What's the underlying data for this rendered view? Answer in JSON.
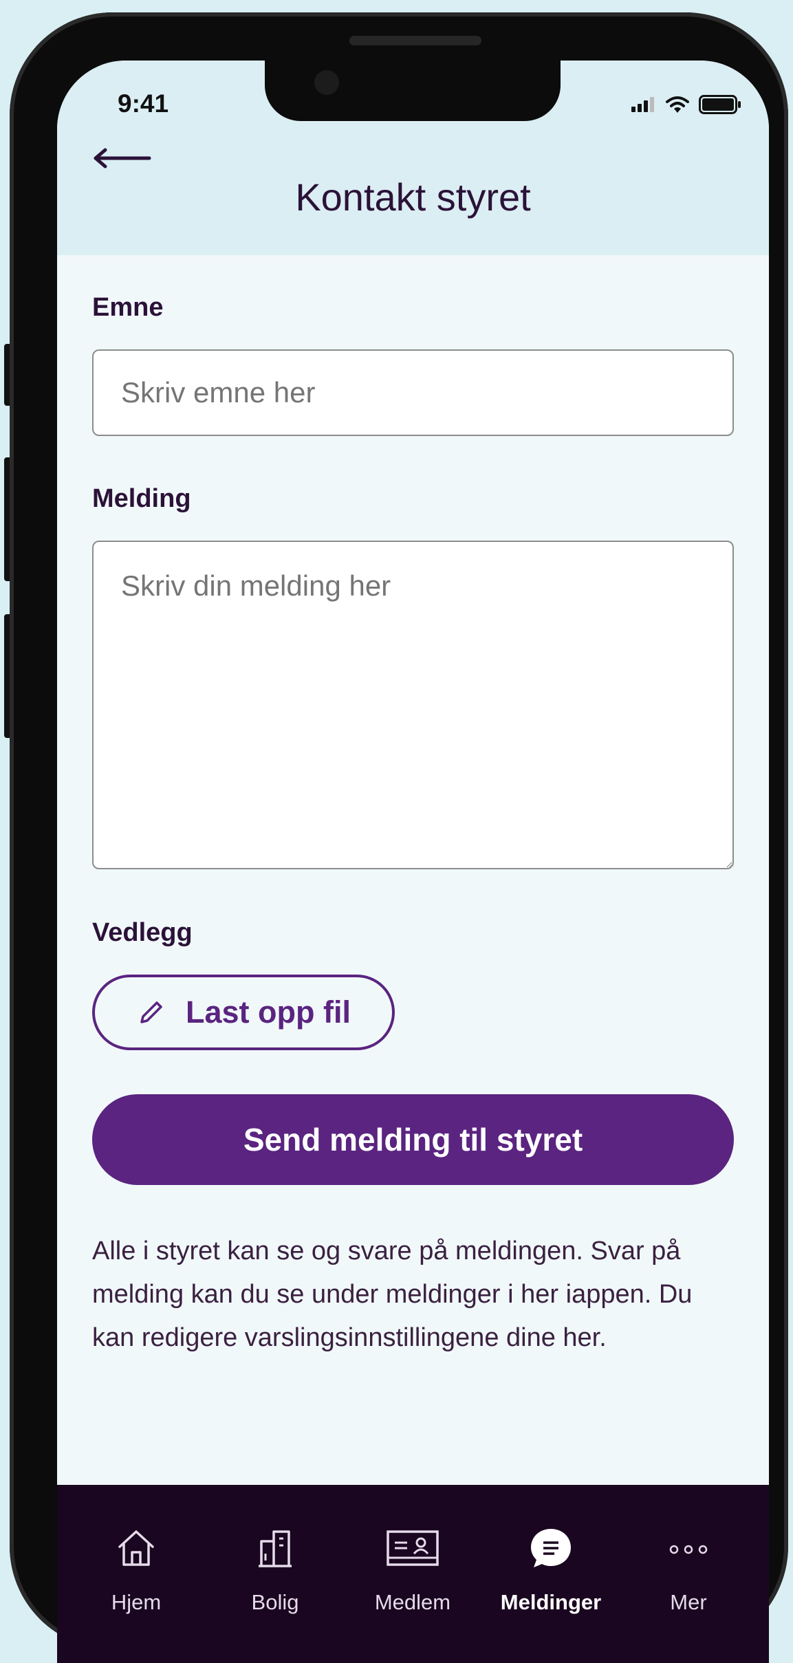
{
  "status_bar": {
    "time": "9:41"
  },
  "header": {
    "title": "Kontakt styret"
  },
  "form": {
    "subject_label": "Emne",
    "subject_placeholder": "Skriv emne her",
    "message_label": "Melding",
    "message_placeholder": "Skriv din melding her",
    "attachment_label": "Vedlegg",
    "upload_button": "Last opp fil",
    "send_button": "Send melding til styret",
    "info_text": "Alle i styret kan se og svare på meldingen. Svar på melding kan du se under meldinger i her iappen. Du kan redigere varslingsinnstillingene dine her."
  },
  "tabbar": {
    "items": [
      {
        "label": "Hjem",
        "icon": "home-icon",
        "active": false
      },
      {
        "label": "Bolig",
        "icon": "building-icon",
        "active": false
      },
      {
        "label": "Medlem",
        "icon": "member-card-icon",
        "active": false
      },
      {
        "label": "Meldinger",
        "icon": "chat-bubble-icon",
        "active": true
      },
      {
        "label": "Mer",
        "icon": "more-dots-icon",
        "active": false
      }
    ]
  },
  "colors": {
    "accent": "#5a2480",
    "header_bg": "#dbeef3",
    "tabbar_bg": "#1a0620",
    "page_bg": "#f1f8fa"
  }
}
